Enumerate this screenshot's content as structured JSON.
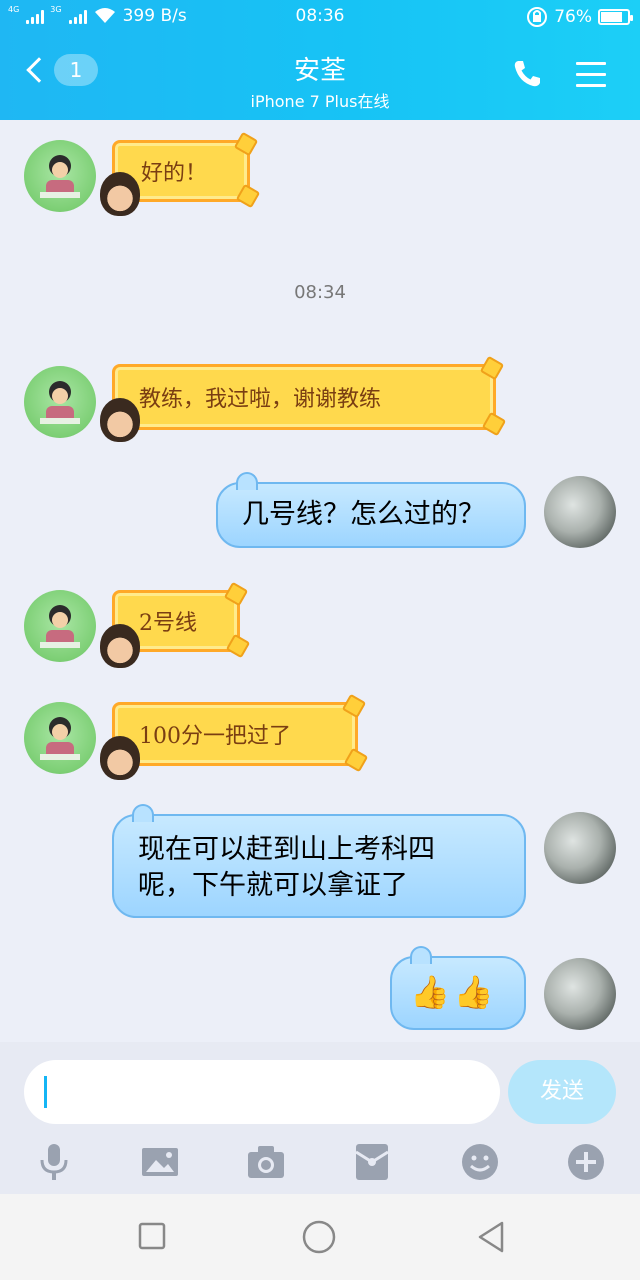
{
  "status_bar": {
    "net1": "4G",
    "net2": "3G",
    "speed": "399 B/s",
    "time": "08:36",
    "battery": "76%",
    "battery_level": 0.76
  },
  "header": {
    "unread": "1",
    "title": "安荃",
    "subtitle": "iPhone 7 Plus在线",
    "phone_icon": "phone-icon",
    "menu_icon": "menu-icon"
  },
  "chat": {
    "timestamp": "08:34",
    "messages": [
      {
        "side": "left",
        "style": "gold",
        "text": "好的！"
      },
      {
        "side": "left",
        "style": "gold",
        "text": "教练，我过啦，谢谢教练"
      },
      {
        "side": "right",
        "style": "blue",
        "text": "几号线？怎么过的？"
      },
      {
        "side": "left",
        "style": "gold",
        "text": "2号线"
      },
      {
        "side": "left",
        "style": "gold",
        "text": "100分一把过了"
      },
      {
        "side": "right",
        "style": "blue",
        "text_line1": "现在可以赶到山上考科四",
        "text_line2": "呢，下午就可以拿证了"
      },
      {
        "side": "right",
        "style": "blue",
        "text": "👍👍"
      }
    ]
  },
  "composer": {
    "send_label": "发送",
    "tools": [
      "microphone-icon",
      "image-icon",
      "camera-icon",
      "red-packet-icon",
      "emoji-icon",
      "plus-icon"
    ]
  },
  "colors": {
    "header": "#1fb7f3",
    "gold_bubble": "#ffd94d",
    "blue_bubble": "#9dd5ff",
    "send_button": "#b4e6fb"
  }
}
